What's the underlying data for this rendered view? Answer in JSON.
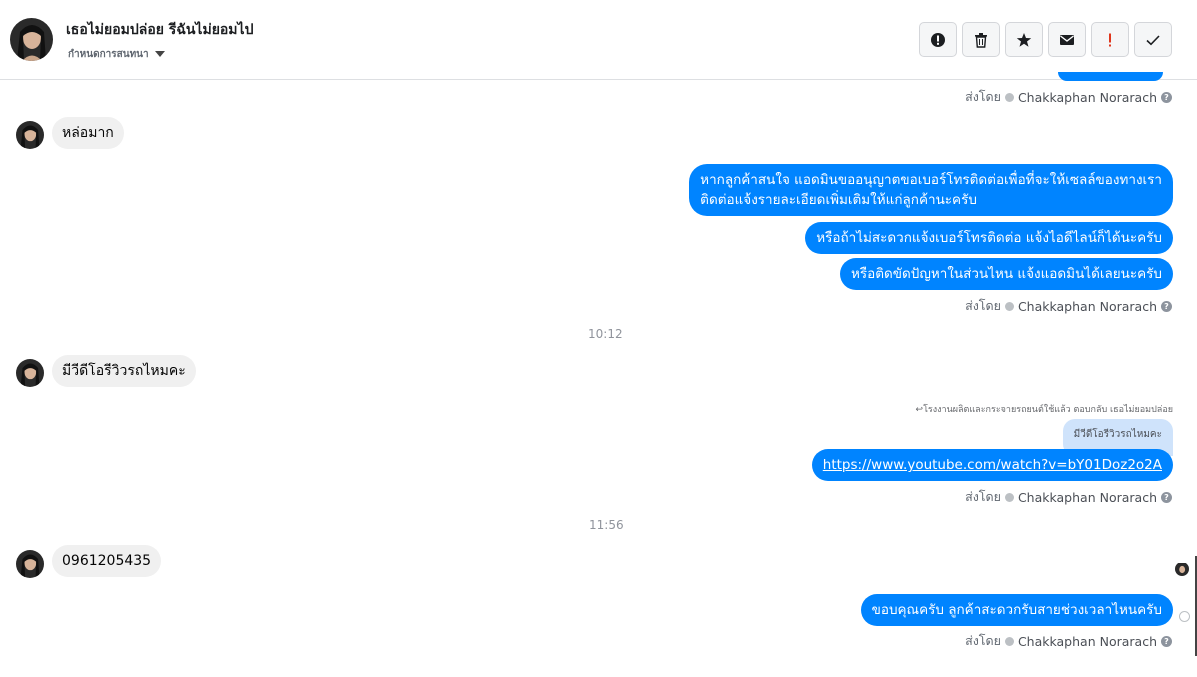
{
  "header": {
    "title": "เธอไม่ยอมปล่อย รีฉันไม่ยอมไป",
    "subtitle": "กำหนดการสนทนา",
    "actions": [
      {
        "name": "alert-icon"
      },
      {
        "name": "trash-icon"
      },
      {
        "name": "star-icon"
      },
      {
        "name": "envelope-icon"
      },
      {
        "name": "exclamation-icon"
      },
      {
        "name": "checkmark-icon"
      }
    ]
  },
  "sent_by": {
    "prefix": "ส่งโดย",
    "agent": "Chakkaphan Norarach",
    "help": "?"
  },
  "messages": {
    "in1": "หล่อมาก",
    "out1_line1": "หากลูกค้าสนใจ แอดมินขออนุญาตขอเบอร์โทรติดต่อเพื่อที่จะให้เซลล์ของทางเรา",
    "out1_line2": "ติดต่อแจ้งรายละเอียดเพิ่มเติมให้แก่ลูกค้านะครับ",
    "out2": "หรือถ้าไม่สะดวกแจ้งเบอร์โทรติดต่อ แจ้งไอดีไลน์ก็ได้นะครับ",
    "out3": "หรือติดขัดปัญหาในส่วนไหน แจ้งแอดมินได้เลยนะครับ",
    "time1": "10:12",
    "in2": "มีวีดีโอรีวิวรถไหมคะ",
    "reply_note": "↩โรงงานผลิตและกระจายรถยนต์ใช้แล้ว ตอบกลับ เธอไม่ยอมปล่อย",
    "reply_quote": "มีวีดีโอรีวิวรถไหมคะ",
    "link": "https://www.youtube.com/watch?v=bY01Doz2o2A",
    "time2": "11:56",
    "in3": "0961205435",
    "out4": "ขอบคุณครับ ลูกค้าสะดวกรับสายช่วงเวลาไหนครับ"
  },
  "colors": {
    "outgoing": "#0084ff",
    "incoming": "#f0f0f0",
    "quote": "#cfe3fb"
  }
}
